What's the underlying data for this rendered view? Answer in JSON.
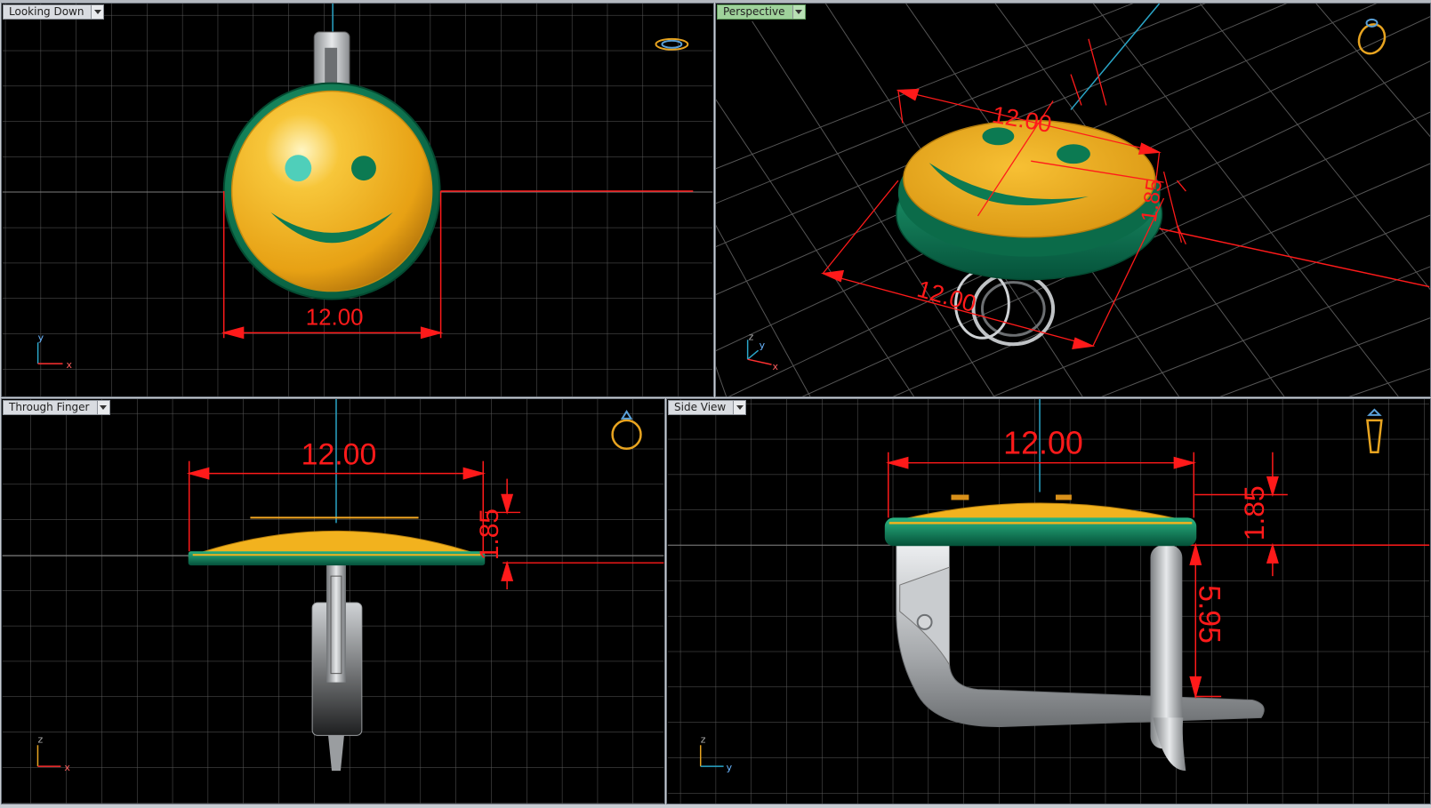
{
  "viewports": {
    "top_left": {
      "label": "Looking Down",
      "dimension": "12.00",
      "axes": {
        "a": "y",
        "b": "x"
      }
    },
    "top_right": {
      "label": "Perspective",
      "dim_top": "12.00",
      "dim_front": "12.00",
      "dim_height": "1.85",
      "axes": {
        "a": "z",
        "b": "y",
        "c": "x"
      }
    },
    "bottom_left": {
      "label": "Through Finger",
      "dim_width": "12.00",
      "dim_height": "1.85",
      "axes": {
        "a": "z",
        "b": "x"
      }
    },
    "bottom_right": {
      "label": "Side View",
      "dim_width": "12.00",
      "dim_height": "1.85",
      "dim_gap": "5.95",
      "axes": {
        "a": "z",
        "b": "y"
      }
    }
  },
  "colors": {
    "grid": "#5a5a5a",
    "dimension": "#ff1a1a",
    "gold": "#f2b21e",
    "enamel": "#0e7a55",
    "metal": "#b9bcbf",
    "axis_cyan": "#2aa6c8",
    "active_tab": "#9fd29b"
  }
}
